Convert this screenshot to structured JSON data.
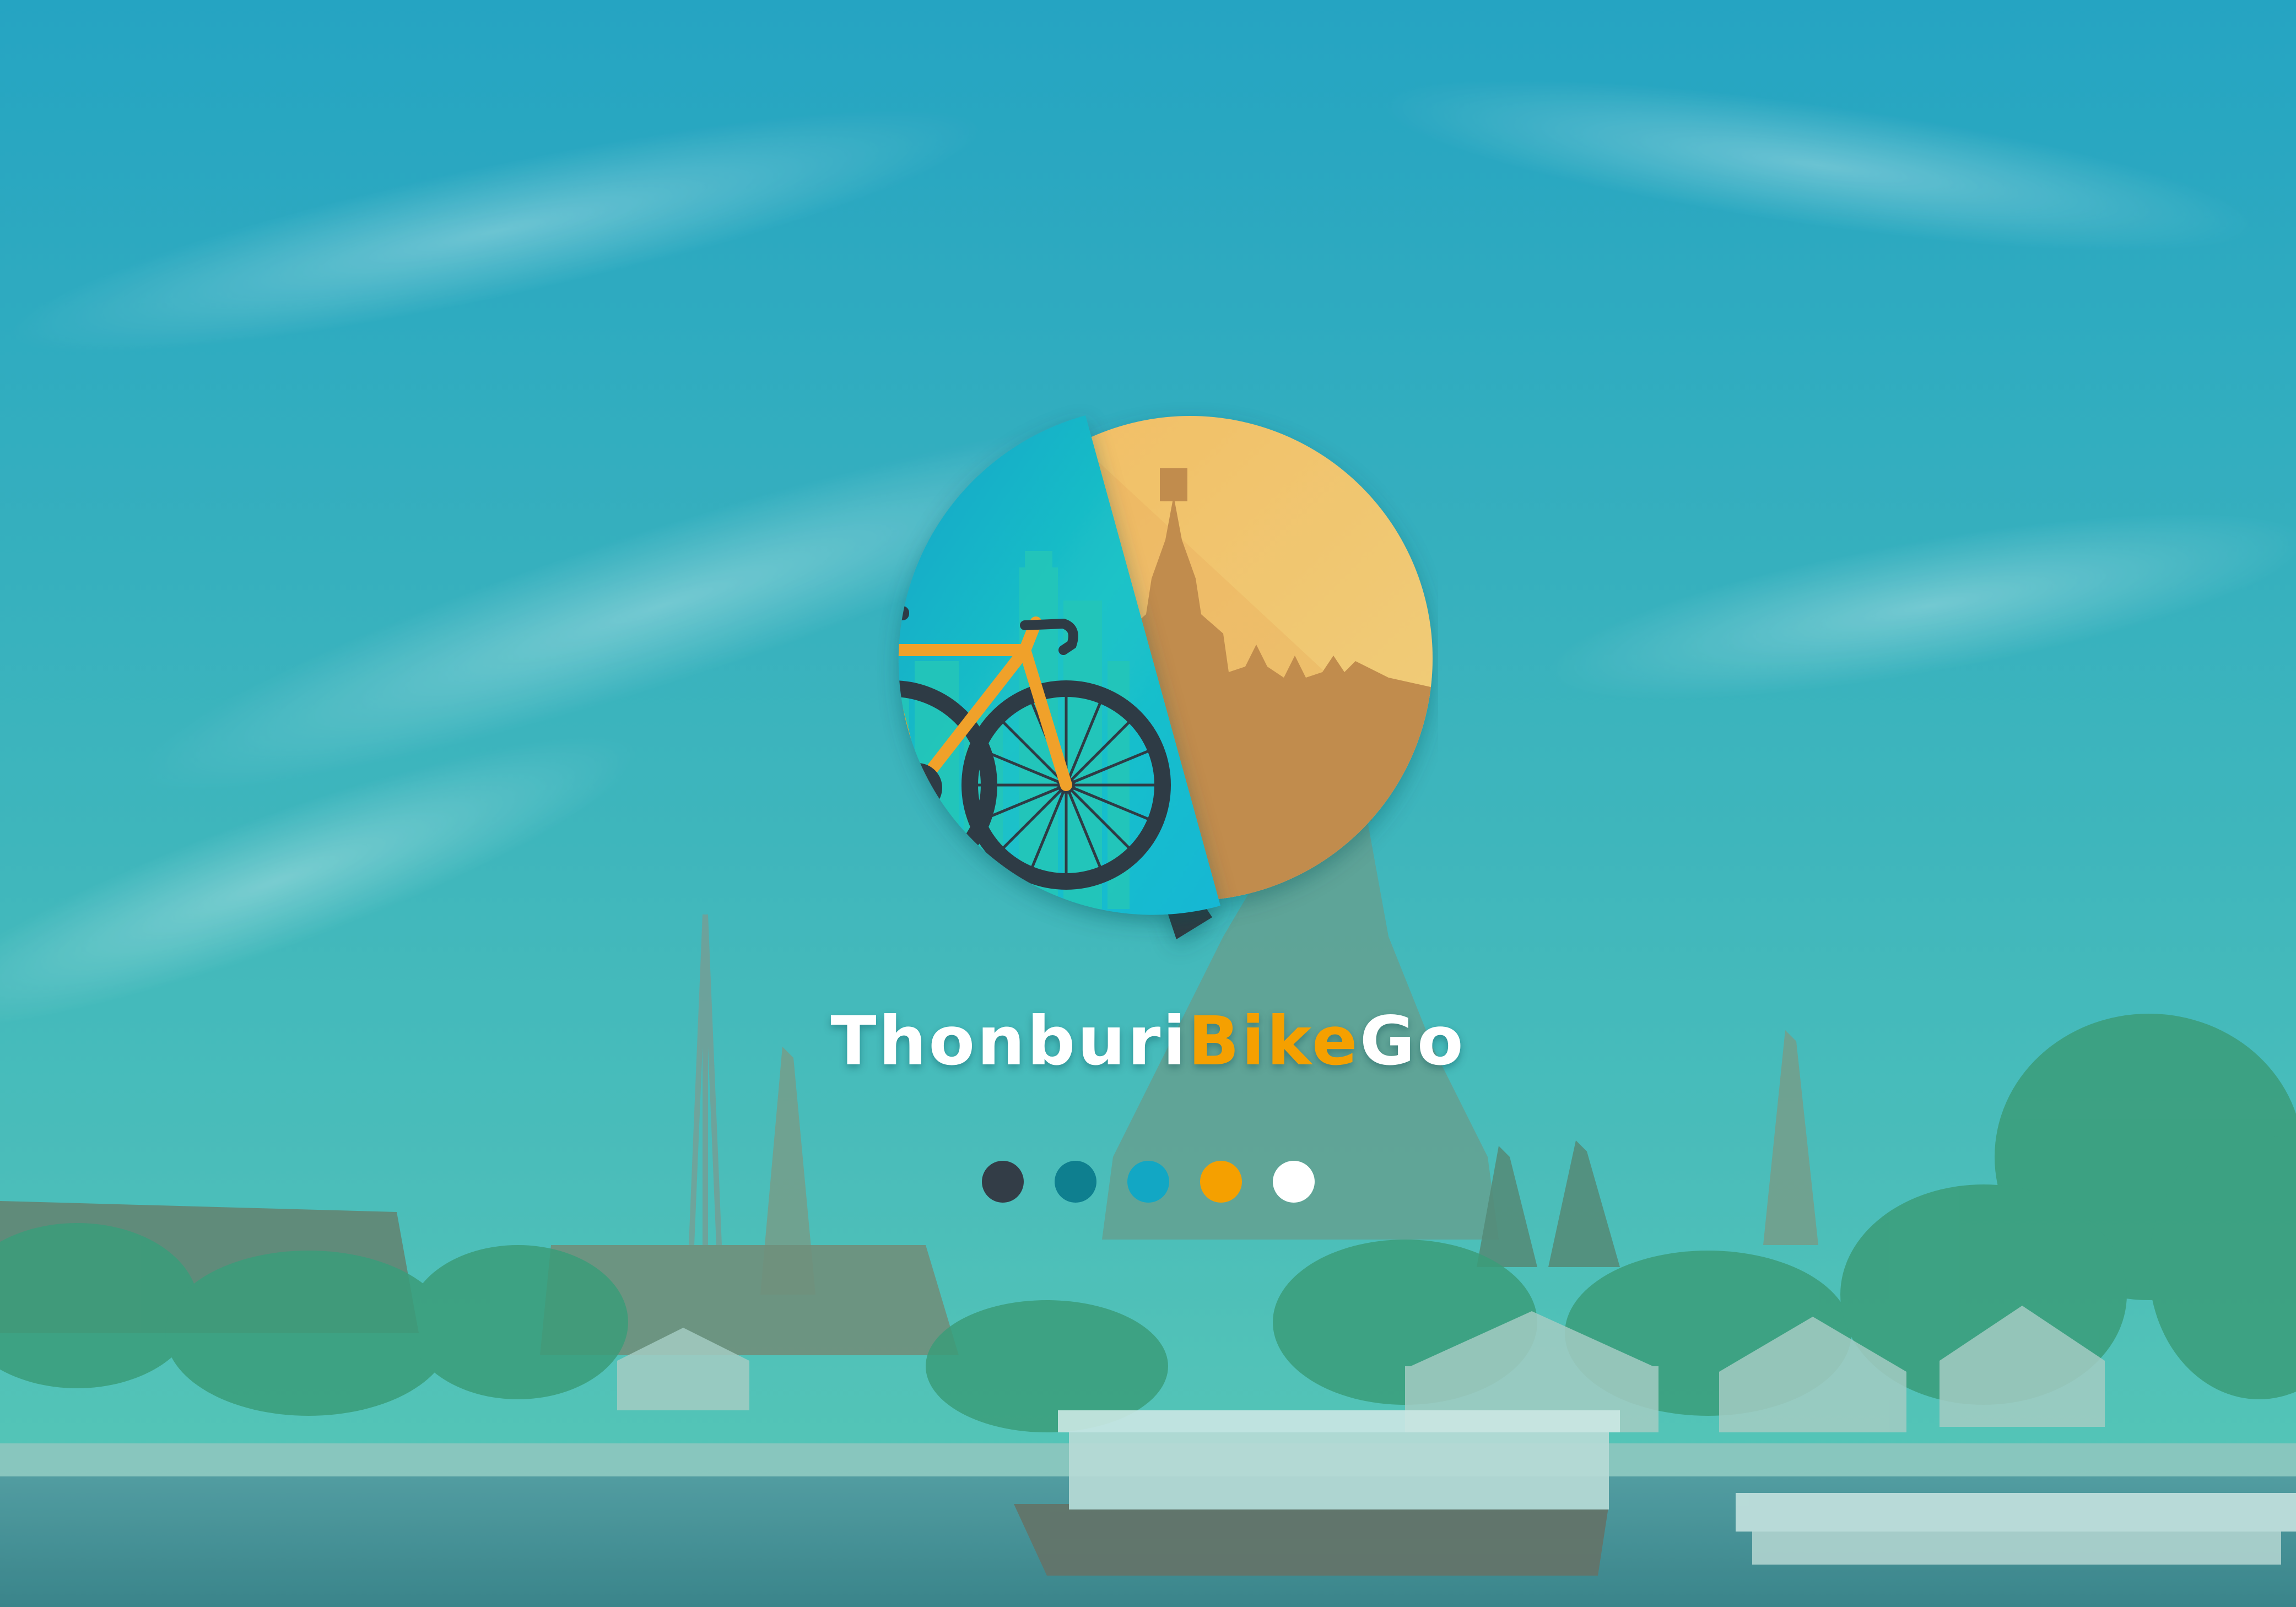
{
  "brand": {
    "name_part1": "Thonburi",
    "name_part2": "Bike",
    "name_part3": "Go",
    "color_white": "#ffffff",
    "color_orange": "#f5a000"
  },
  "palette": [
    {
      "name": "charcoal",
      "color": "#333d47"
    },
    {
      "name": "petrol",
      "color": "#0e7f8f"
    },
    {
      "name": "cyan",
      "color": "#12a7c4"
    },
    {
      "name": "orange",
      "color": "#f5a000"
    },
    {
      "name": "white",
      "color": "#ffffff"
    }
  ],
  "scene": {
    "sky_top": "#2aa4c4",
    "sky_bottom": "#5cc7b8",
    "river": "#4e8e94"
  },
  "icons": [
    "bicycle-icon",
    "temple-icon",
    "city-skyline-icon"
  ]
}
